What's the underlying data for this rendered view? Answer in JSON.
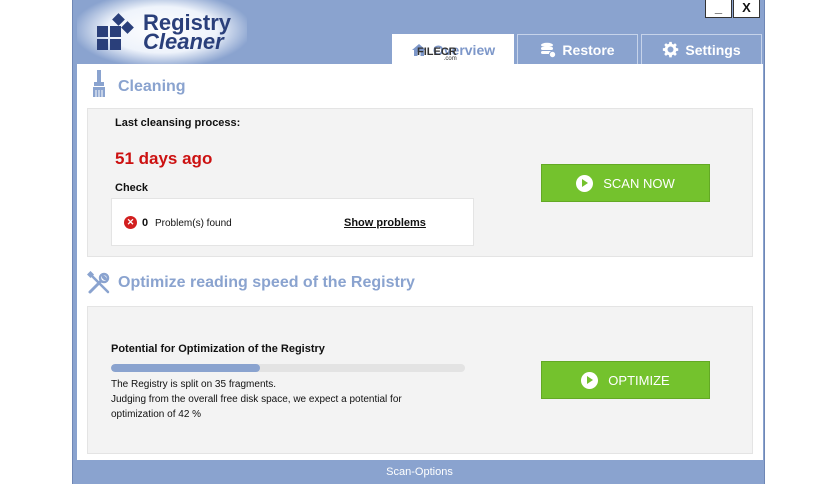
{
  "app": {
    "title_line1": "Registry",
    "title_line2": "Cleaner",
    "minimize_label": "_",
    "close_label": "X"
  },
  "tabs": [
    {
      "label": "Overview",
      "icon": "home-icon",
      "active": true
    },
    {
      "label": "Restore",
      "icon": "database-icon",
      "active": false
    },
    {
      "label": "Settings",
      "icon": "gear-icon",
      "active": false
    }
  ],
  "watermark": {
    "text": "FILECR",
    "sub": ".com"
  },
  "cleaning": {
    "title": "Cleaning",
    "last_label": "Last cleansing process:",
    "last_value": "51 days ago",
    "check_label": "Check",
    "problems_count": "0",
    "problems_text": "Problem(s) found",
    "show_problems": "Show problems",
    "scan_button": "SCAN NOW"
  },
  "optimize": {
    "title": "Optimize reading speed of the Registry",
    "potential_label": "Potential for Optimization of the Registry",
    "progress_fraction": 0.42,
    "line1": "The Registry is split on 35 fragments.",
    "line2": "Judging from the overall free disk space, we expect a potential for",
    "line3": "optimization of 42 %",
    "optimize_button": "OPTIMIZE"
  },
  "footer": {
    "scan_options": "Scan-Options"
  },
  "colors": {
    "accent": "#8aa3cf",
    "green": "#74c22d",
    "red": "#cc1111",
    "logo": "#2a3f7a"
  }
}
